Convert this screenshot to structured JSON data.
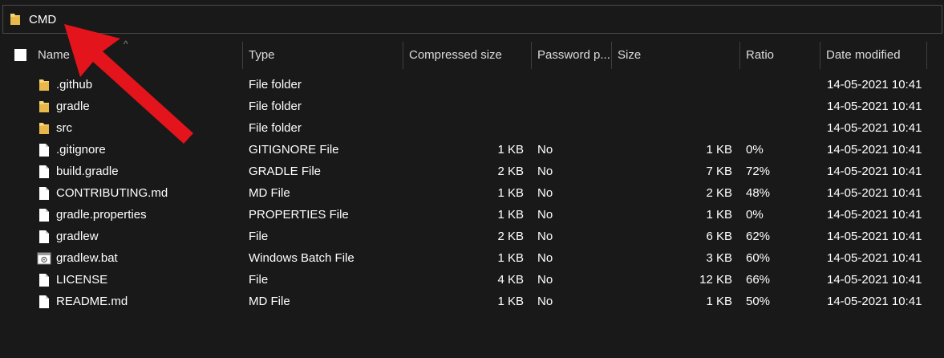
{
  "address_bar": {
    "path": "CMD",
    "icon": "folder-icon"
  },
  "columns": {
    "name": "Name",
    "type": "Type",
    "compressed_size": "Compressed size",
    "password": "Password p...",
    "size": "Size",
    "ratio": "Ratio",
    "date_modified": "Date modified"
  },
  "files": [
    {
      "icon": "folder-icon",
      "name": ".github",
      "type": "File folder",
      "compressed": "",
      "password": "",
      "size": "",
      "ratio": "",
      "date": "14-05-2021 10:41"
    },
    {
      "icon": "folder-icon",
      "name": "gradle",
      "type": "File folder",
      "compressed": "",
      "password": "",
      "size": "",
      "ratio": "",
      "date": "14-05-2021 10:41"
    },
    {
      "icon": "folder-icon",
      "name": "src",
      "type": "File folder",
      "compressed": "",
      "password": "",
      "size": "",
      "ratio": "",
      "date": "14-05-2021 10:41"
    },
    {
      "icon": "file-icon",
      "name": ".gitignore",
      "type": "GITIGNORE File",
      "compressed": "1 KB",
      "password": "No",
      "size": "1 KB",
      "ratio": "0%",
      "date": "14-05-2021 10:41"
    },
    {
      "icon": "file-icon",
      "name": "build.gradle",
      "type": "GRADLE File",
      "compressed": "2 KB",
      "password": "No",
      "size": "7 KB",
      "ratio": "72%",
      "date": "14-05-2021 10:41"
    },
    {
      "icon": "file-icon",
      "name": "CONTRIBUTING.md",
      "type": "MD File",
      "compressed": "1 KB",
      "password": "No",
      "size": "2 KB",
      "ratio": "48%",
      "date": "14-05-2021 10:41"
    },
    {
      "icon": "file-icon",
      "name": "gradle.properties",
      "type": "PROPERTIES File",
      "compressed": "1 KB",
      "password": "No",
      "size": "1 KB",
      "ratio": "0%",
      "date": "14-05-2021 10:41"
    },
    {
      "icon": "file-icon",
      "name": "gradlew",
      "type": "File",
      "compressed": "2 KB",
      "password": "No",
      "size": "6 KB",
      "ratio": "62%",
      "date": "14-05-2021 10:41"
    },
    {
      "icon": "batch-file-icon",
      "name": "gradlew.bat",
      "type": "Windows Batch File",
      "compressed": "1 KB",
      "password": "No",
      "size": "3 KB",
      "ratio": "60%",
      "date": "14-05-2021 10:41"
    },
    {
      "icon": "file-icon",
      "name": "LICENSE",
      "type": "File",
      "compressed": "4 KB",
      "password": "No",
      "size": "12 KB",
      "ratio": "66%",
      "date": "14-05-2021 10:41"
    },
    {
      "icon": "file-icon",
      "name": "README.md",
      "type": "MD File",
      "compressed": "1 KB",
      "password": "No",
      "size": "1 KB",
      "ratio": "50%",
      "date": "14-05-2021 10:41"
    }
  ],
  "colors": {
    "background": "#191919",
    "text": "#ffffff",
    "folder": "#f8d775",
    "arrow": "#e3141b"
  }
}
